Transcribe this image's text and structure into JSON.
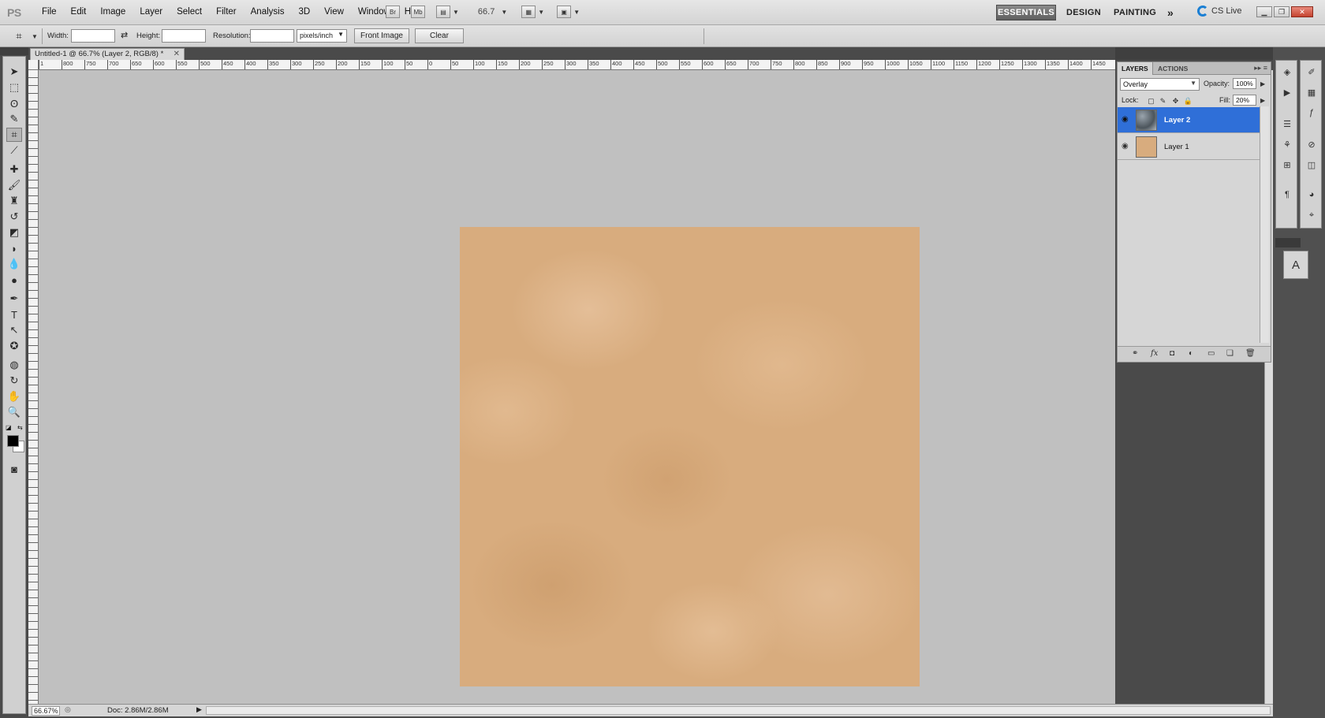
{
  "app": {
    "logo": "PS"
  },
  "menu": [
    "File",
    "Edit",
    "Image",
    "Layer",
    "Select",
    "Filter",
    "Analysis",
    "3D",
    "View",
    "Window",
    "Help"
  ],
  "menubar": {
    "br_label": "Br",
    "mb_label": "Mb",
    "zoom_value": "66.7",
    "workspaces": {
      "essentials": "ESSENTIALS",
      "design": "DESIGN",
      "painting": "PAINTING",
      "more": "»"
    },
    "cslive": "CS Live"
  },
  "options": {
    "width_label": "Width:",
    "width_value": "",
    "height_label": "Height:",
    "height_value": "",
    "resolution_label": "Resolution:",
    "resolution_value": "",
    "units": "pixels/inch",
    "front_image": "Front Image",
    "clear": "Clear"
  },
  "document": {
    "tab_title": "Untitled-1 @ 66.7% (Layer 2, RGB/8) *",
    "ruler_ticks": [
      "1",
      "800",
      "750",
      "700",
      "650",
      "600",
      "550",
      "500",
      "450",
      "400",
      "350",
      "300",
      "250",
      "200",
      "150",
      "100",
      "50",
      "0",
      "50",
      "100",
      "150",
      "200",
      "250",
      "300",
      "350",
      "400",
      "450",
      "500",
      "550",
      "600",
      "650",
      "700",
      "750",
      "800",
      "850",
      "900",
      "950",
      "1000",
      "1050",
      "1100",
      "1150",
      "1200",
      "1250",
      "1300",
      "1350",
      "1400",
      "1450"
    ],
    "canvas_color": "#d8ac7e"
  },
  "status": {
    "zoom": "66.67%",
    "doc_info": "Doc: 2.86M/2.86M"
  },
  "layers_panel": {
    "tabs": [
      "LAYERS",
      "ACTIONS"
    ],
    "blend_mode": "Overlay",
    "opacity_label": "Opacity:",
    "opacity_value": "100%",
    "lock_label": "Lock:",
    "fill_label": "Fill:",
    "fill_value": "20%",
    "layers": [
      {
        "name": "Layer 2",
        "selected": true,
        "visible": true
      },
      {
        "name": "Layer 1",
        "selected": false,
        "visible": true
      }
    ]
  },
  "colors": {
    "accent_selected": "#2f6fd8",
    "foreground": "#000000",
    "background": "#ffffff"
  }
}
